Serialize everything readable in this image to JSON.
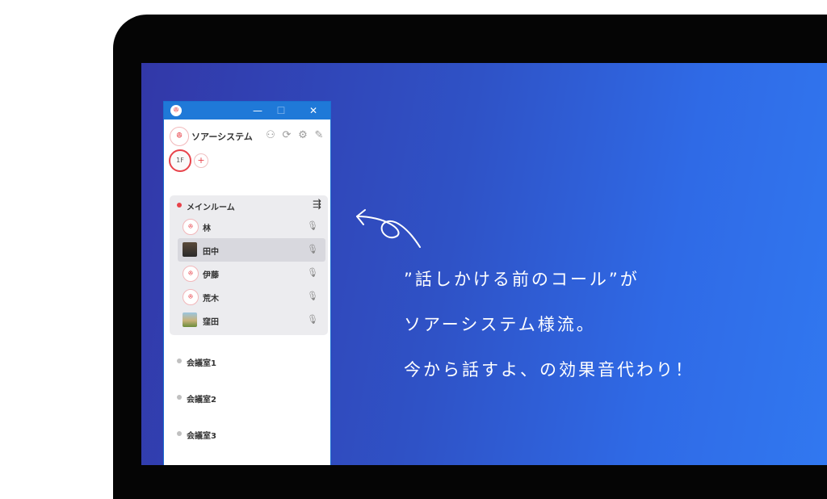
{
  "window": {
    "app_icon": "ghost-logo-icon",
    "minimize": "—",
    "maximize": "☐",
    "close": "✕"
  },
  "header": {
    "org_name": "ソアーシステム",
    "icons": [
      "add-user-icon",
      "refresh-icon",
      "gear-icon",
      "pin-icon"
    ]
  },
  "floors": {
    "current": "1F",
    "add": "+"
  },
  "main_room": {
    "label": "メインルーム",
    "members": [
      {
        "name": "林",
        "avatar": "ghost"
      },
      {
        "name": "田中",
        "avatar": "photo"
      },
      {
        "name": "伊藤",
        "avatar": "ghost"
      },
      {
        "name": "荒木",
        "avatar": "ghost"
      },
      {
        "name": "窪田",
        "avatar": "scene"
      }
    ]
  },
  "rooms": [
    {
      "label": "会議室1"
    },
    {
      "label": "会議室2"
    },
    {
      "label": "会議室3"
    }
  ],
  "annotation": {
    "line1": "”話しかける前のコール”が",
    "line2": "ソアーシステム様流。",
    "line3": "今から話すよ、の効果音代わり！"
  },
  "colors": {
    "accent_red": "#e8434b",
    "titlebar_blue": "#1f79d8",
    "background_gradient_start": "#3238a8",
    "background_gradient_end": "#3178f0"
  }
}
